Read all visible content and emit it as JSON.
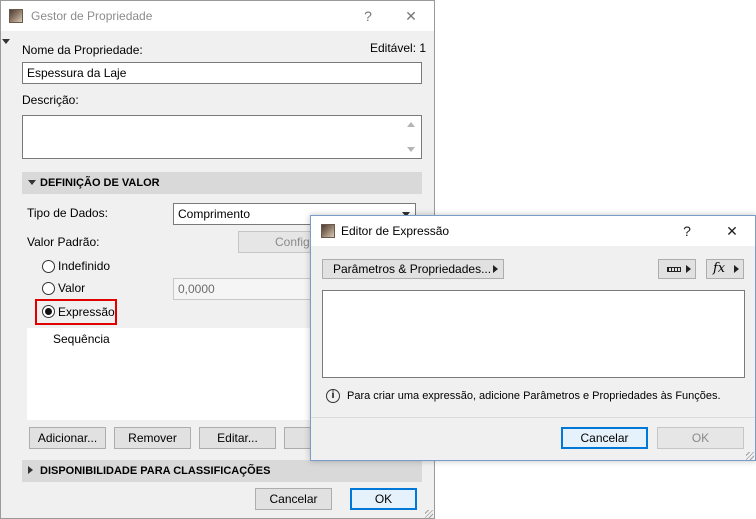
{
  "property_manager": {
    "title": "Gestor de Propriedade",
    "name_label": "Nome da Propriedade:",
    "editable_text": "Editável: 1",
    "name_value": "Espessura da Laje",
    "description_label": "Descrição:",
    "description_value": "",
    "value_definition_header": "DEFINIÇÃO DE VALOR",
    "data_type_label": "Tipo de Dados:",
    "data_type_value": "Comprimento",
    "default_value_label": "Valor Padrão:",
    "configure_label": "Configu",
    "radio_options": [
      {
        "label": "Indefinido",
        "selected": false
      },
      {
        "label": "Valor",
        "selected": false
      },
      {
        "label": "Expressão",
        "selected": true
      }
    ],
    "value_field": "0,0000",
    "list_items": [
      "Sequência"
    ],
    "buttons": {
      "add": "Adicionar...",
      "remove": "Remover",
      "edit": "Editar..."
    },
    "availability_header": "DISPONIBILIDADE PARA CLASSIFICAÇÕES",
    "cancel": "Cancelar",
    "ok": "OK",
    "highlight_color": "#e00000"
  },
  "expression_editor": {
    "title": "Editor de Expressão",
    "params_button": "Parâmetros & Propriedades...",
    "info_text": "Para criar uma expressão, adicione Parâmetros e Propriedades às Funções.",
    "cancel": "Cancelar",
    "ok": "OK",
    "icons": [
      "ruler-icon",
      "function-icon",
      "info-icon"
    ]
  },
  "title_buttons": {
    "help": "?",
    "close": "✕"
  }
}
